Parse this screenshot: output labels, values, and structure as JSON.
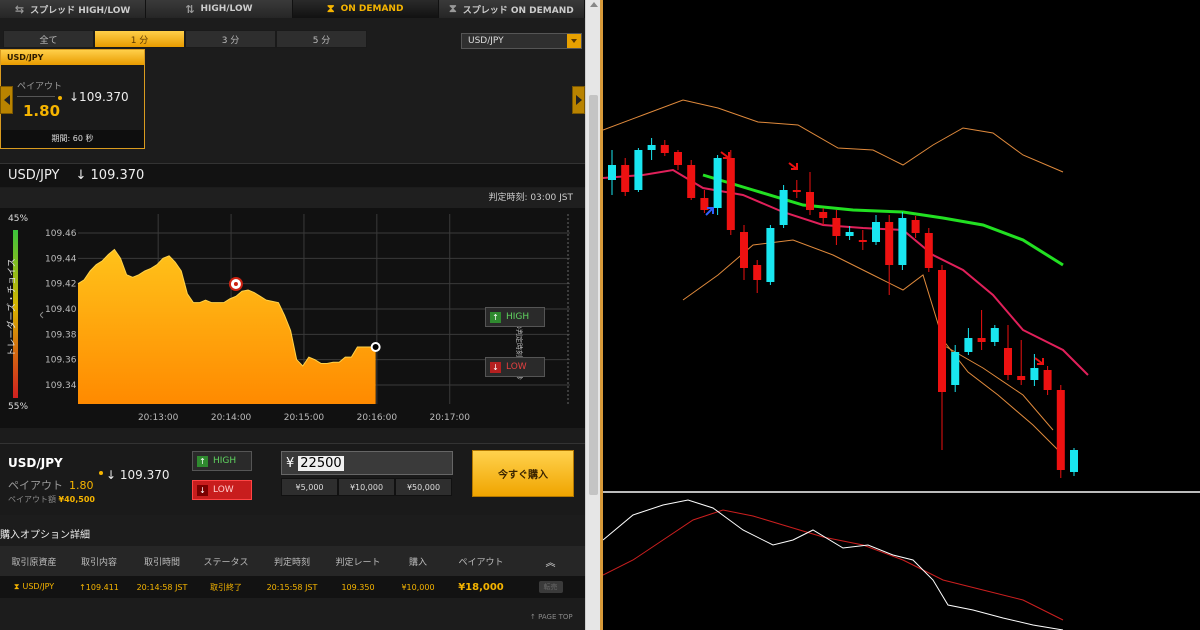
{
  "top_tabs": [
    {
      "label": "スプレッド HIGH/LOW",
      "icon": "swap-arrows-icon"
    },
    {
      "label": "HIGH/LOW",
      "icon": "up-down-arrows-icon"
    },
    {
      "label": "ON DEMAND",
      "icon": "hourglass-icon",
      "active": true
    },
    {
      "label": "スプレッド ON DEMAND",
      "icon": "hourglass-icon"
    }
  ],
  "time_tabs": [
    "全て",
    "1 分",
    "3 分",
    "5 分"
  ],
  "pair_select": "USD/JPY",
  "card": {
    "pair": "USD/JPY",
    "payout_label": "ペイアウト",
    "payout": "1.80",
    "rate": "↓109.370",
    "period": "期間: 60 秒"
  },
  "chart_header": {
    "pair": "USD/JPY",
    "rate": "↓ 109.370",
    "judge_time": "判定時刻:   03:00 JST"
  },
  "chart_data": {
    "type": "area",
    "y_ticks": [
      "109.46",
      "109.44",
      "109.42",
      "109.40",
      "109.38",
      "109.36",
      "109.34"
    ],
    "x_ticks": [
      "20:13:00",
      "20:14:00",
      "20:15:00",
      "20:16:00",
      "20:17:00"
    ],
    "ylim": [
      109.325,
      109.475
    ],
    "x": [
      0,
      5,
      10,
      15,
      20,
      25,
      30,
      35,
      40,
      45,
      50,
      55,
      60,
      65,
      70,
      75,
      80,
      85,
      90,
      95,
      100,
      105,
      110,
      115,
      120,
      125,
      130,
      135,
      140,
      145,
      150,
      155,
      160,
      165,
      170,
      175,
      180,
      185,
      190,
      195,
      200,
      205,
      210,
      215,
      220,
      225,
      230,
      235,
      240,
      245
    ],
    "values": [
      109.42,
      109.423,
      109.43,
      109.435,
      109.438,
      109.443,
      109.447,
      109.44,
      109.427,
      109.425,
      109.427,
      109.43,
      109.432,
      109.435,
      109.44,
      109.442,
      109.437,
      109.43,
      109.412,
      109.405,
      109.405,
      109.407,
      109.405,
      109.405,
      109.405,
      109.408,
      109.41,
      109.414,
      109.415,
      109.413,
      109.41,
      109.407,
      109.406,
      109.405,
      109.395,
      109.383,
      109.36,
      109.355,
      109.362,
      109.36,
      109.357,
      109.357,
      109.358,
      109.358,
      109.362,
      109.362,
      109.37,
      109.37,
      109.37,
      109.37
    ],
    "marker_value": 109.415,
    "trader_choice_top": "45%",
    "trader_choice_bottom": "55%",
    "trader_choice_label": "トレーダーズ・チョイス",
    "side_label": "次回の判定時刻: 60 秒",
    "colors": {
      "area_top": "#ffc21a",
      "area_bottom": "#ff8a00",
      "grid": "#3a3a3a"
    }
  },
  "chart_buttons": {
    "high": "HIGH",
    "low": "LOW"
  },
  "trade": {
    "pair": "USD/JPY",
    "payout_label": "ペイアウト",
    "payout": "1.80",
    "amount_label": "ペイアウト額",
    "amount": "¥40,500",
    "rate": "↓ 109.370",
    "high": "HIGH",
    "low": "LOW",
    "currency": "¥",
    "amount_value": "22500",
    "quick": [
      "¥5,000",
      "¥10,000",
      "¥50,000"
    ],
    "buy": "今すぐ購入"
  },
  "details": {
    "title": "購入オプション詳細",
    "headers": [
      "取引原資産",
      "取引内容",
      "取引時間",
      "ステータス",
      "判定時刻",
      "判定レート",
      "購入",
      "ペイアウト"
    ],
    "row": [
      "USD/JPY",
      "↑109.411",
      "20:14:58 JST",
      "取引終了",
      "20:15:58 JST",
      "109.350",
      "¥10,000",
      "¥18,000",
      "転売"
    ],
    "page_top": "↑ PAGE TOP"
  },
  "candles": [
    {
      "o": 180,
      "c": 165,
      "h": 150,
      "l": 195
    },
    {
      "o": 165,
      "c": 192,
      "h": 158,
      "l": 196
    },
    {
      "o": 190,
      "c": 150,
      "h": 148,
      "l": 192
    },
    {
      "o": 150,
      "c": 145,
      "h": 138,
      "l": 160
    },
    {
      "o": 145,
      "c": 153,
      "h": 140,
      "l": 156
    },
    {
      "o": 152,
      "c": 165,
      "h": 150,
      "l": 170
    },
    {
      "o": 165,
      "c": 198,
      "h": 160,
      "l": 200
    },
    {
      "o": 198,
      "c": 210,
      "h": 190,
      "l": 213
    },
    {
      "o": 208,
      "c": 158,
      "h": 155,
      "l": 215
    },
    {
      "o": 158,
      "c": 230,
      "h": 150,
      "l": 235
    },
    {
      "o": 232,
      "c": 268,
      "h": 225,
      "l": 280
    },
    {
      "o": 265,
      "c": 280,
      "h": 260,
      "l": 293
    },
    {
      "o": 282,
      "c": 228,
      "h": 225,
      "l": 285
    },
    {
      "o": 225,
      "c": 190,
      "h": 185,
      "l": 228
    },
    {
      "o": 190,
      "c": 192,
      "h": 180,
      "l": 198
    },
    {
      "o": 192,
      "c": 210,
      "h": 172,
      "l": 215
    },
    {
      "o": 212,
      "c": 218,
      "h": 208,
      "l": 225
    },
    {
      "o": 218,
      "c": 236,
      "h": 210,
      "l": 245
    },
    {
      "o": 236,
      "c": 232,
      "h": 226,
      "l": 240
    },
    {
      "o": 240,
      "c": 242,
      "h": 230,
      "l": 250
    },
    {
      "o": 242,
      "c": 222,
      "h": 215,
      "l": 245
    },
    {
      "o": 222,
      "c": 265,
      "h": 215,
      "l": 295
    },
    {
      "o": 265,
      "c": 218,
      "h": 212,
      "l": 270
    },
    {
      "o": 220,
      "c": 233,
      "h": 216,
      "l": 238
    },
    {
      "o": 233,
      "c": 268,
      "h": 228,
      "l": 272
    },
    {
      "o": 270,
      "c": 392,
      "h": 265,
      "l": 450
    },
    {
      "o": 385,
      "c": 352,
      "h": 345,
      "l": 392
    },
    {
      "o": 352,
      "c": 338,
      "h": 328,
      "l": 355
    },
    {
      "o": 338,
      "c": 342,
      "h": 310,
      "l": 350
    },
    {
      "o": 342,
      "c": 328,
      "h": 325,
      "l": 346
    },
    {
      "o": 348,
      "c": 375,
      "h": 325,
      "l": 380
    },
    {
      "o": 376,
      "c": 380,
      "h": 340,
      "l": 385
    },
    {
      "o": 380,
      "c": 368,
      "h": 354,
      "l": 386
    },
    {
      "o": 370,
      "c": 390,
      "h": 366,
      "l": 395
    },
    {
      "o": 390,
      "c": 470,
      "h": 385,
      "l": 478
    },
    {
      "o": 472,
      "c": 450,
      "h": 448,
      "l": 476
    }
  ],
  "candle_colors": {
    "bull": "#19e6f0",
    "bear": "#ee1111",
    "bands": "#e08a3c",
    "ma_fast": "#e0205a",
    "ma_slow": "#22e022",
    "osc_white": "#ffffff",
    "osc_red": "#cc1f1f",
    "separator": "#bbbbbb"
  }
}
